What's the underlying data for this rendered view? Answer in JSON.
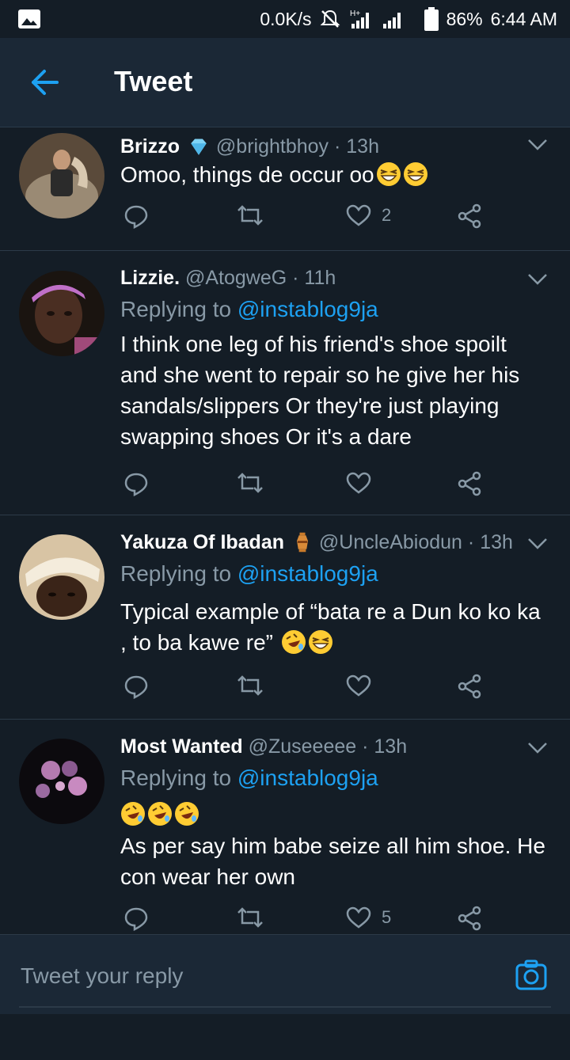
{
  "status_bar": {
    "net_speed": "0.0K/s",
    "battery": "86%",
    "time": "6:44 AM",
    "network": "H+"
  },
  "header": {
    "title": "Tweet"
  },
  "tweets": [
    {
      "name": "Brizzo",
      "handle": "@brightbhoy",
      "time": "13h",
      "replying_to": "",
      "text": "Omoo, things de occur oo",
      "emojis": [
        "grinning-squint-emoji",
        "grinning-squint-emoji"
      ],
      "likes": "2",
      "retweets": ""
    },
    {
      "name": "Lizzie.",
      "handle": "@AtogweG",
      "time": "11h",
      "replying_prefix": "Replying to ",
      "replying_to": "@instablog9ja",
      "text": "I think one leg of his friend's shoe spoilt and she went to repair so he give her his sandals/slippers Or they're just playing swapping shoes Or it's a dare",
      "likes": "",
      "retweets": ""
    },
    {
      "name": "Yakuza Of Ibadan",
      "handle": "@UncleAbiodun",
      "time": "13h",
      "replying_prefix": "Replying to ",
      "replying_to": "@instablog9ja",
      "text": "Typical example of “bata re a Dun ko ko ka , to ba kawe re”",
      "emojis": [
        "rofl-emoji",
        "grinning-squint-emoji"
      ],
      "likes": "",
      "retweets": ""
    },
    {
      "name": "Most Wanted",
      "handle": "@Zuseeeee",
      "time": "13h",
      "replying_prefix": "Replying to ",
      "replying_to": "@instablog9ja",
      "text": "As per say him babe seize all him shoe. He con wear her own",
      "emojis": [
        "rofl-emoji",
        "rofl-emoji",
        "rofl-emoji"
      ],
      "likes": "5",
      "retweets": ""
    }
  ],
  "compose": {
    "placeholder": "Tweet your reply"
  },
  "colors": {
    "background": "#141d26",
    "bar": "#1b2836",
    "accent": "#1da1f2",
    "muted": "#8899a6"
  }
}
